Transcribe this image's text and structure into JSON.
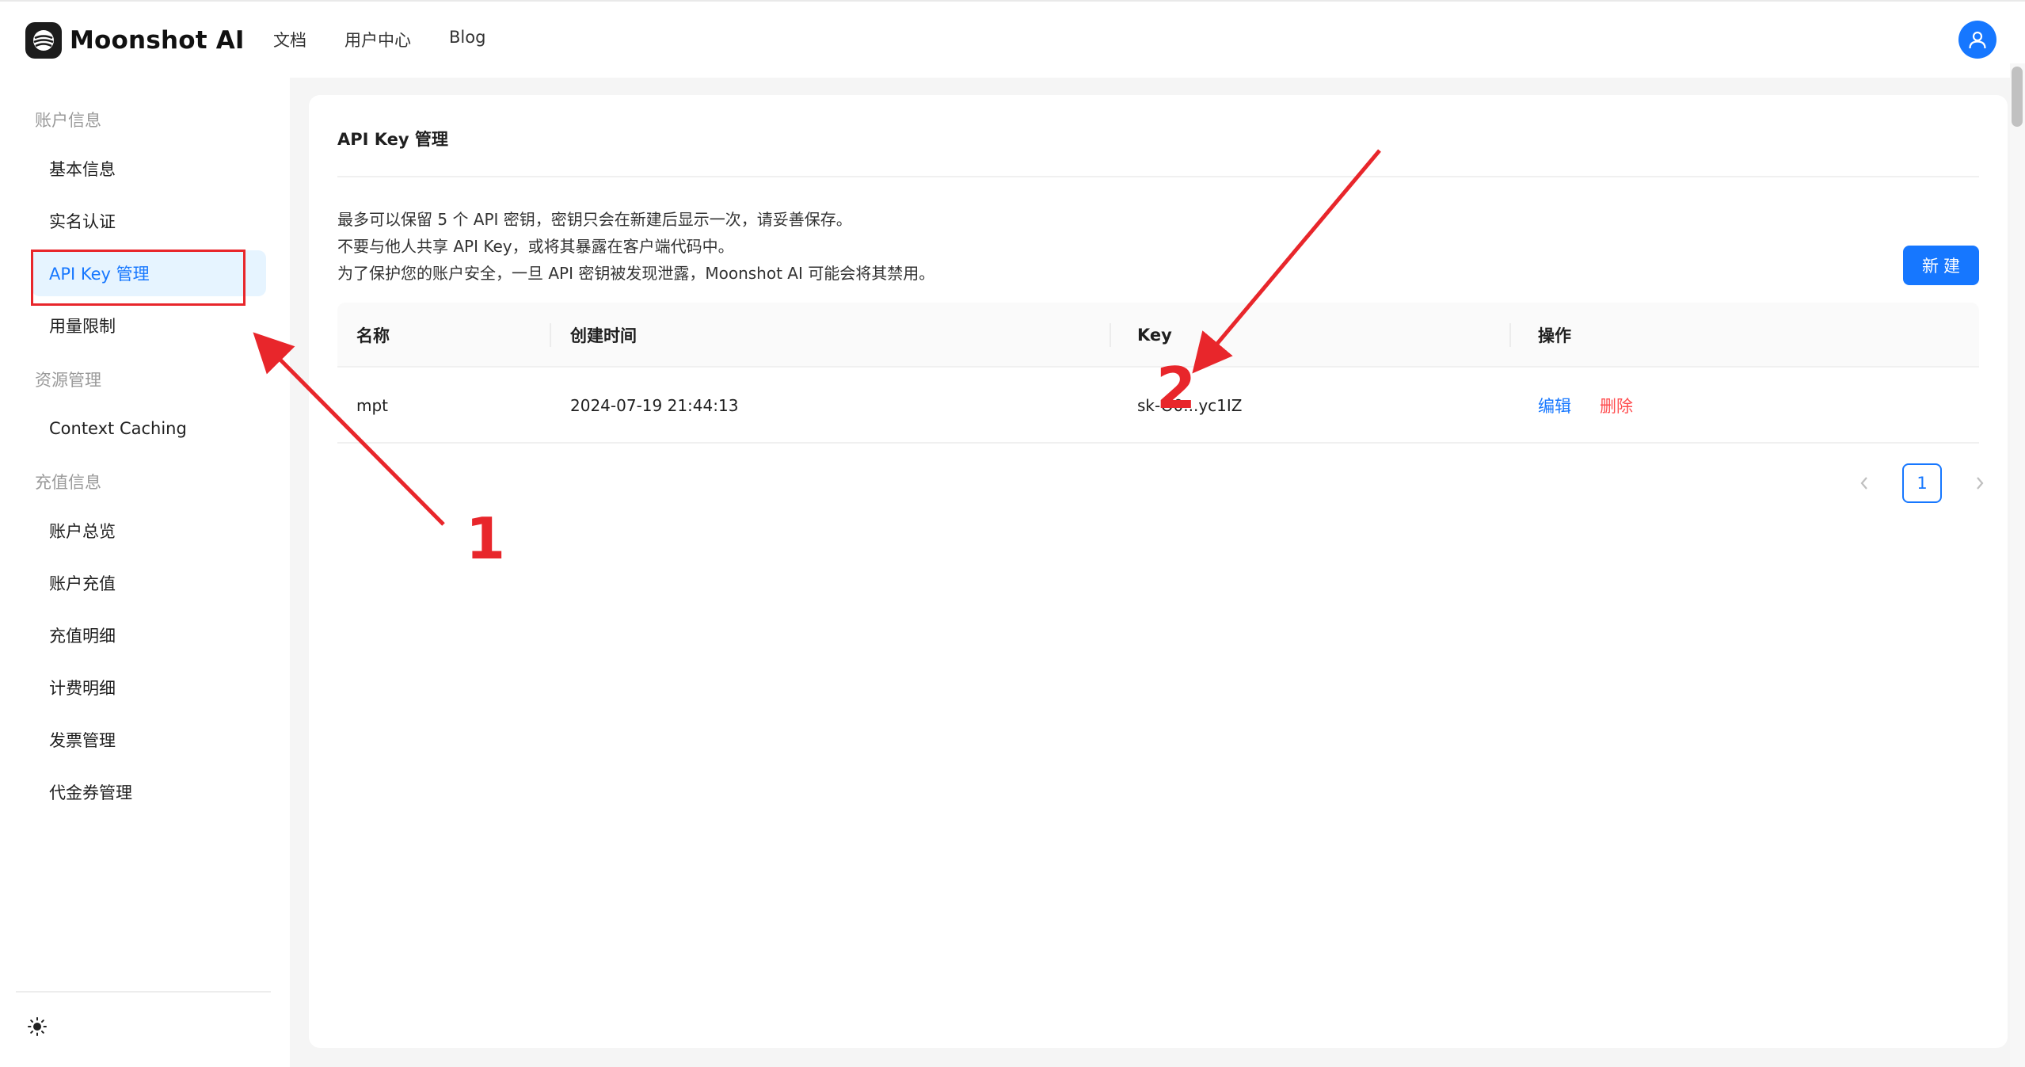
{
  "brand": {
    "name": "Moonshot AI"
  },
  "top_nav": {
    "items": [
      "文档",
      "用户中心",
      "Blog"
    ]
  },
  "sidebar": {
    "groups": [
      {
        "label": "账户信息",
        "items": [
          "基本信息",
          "实名认证",
          "API Key 管理",
          "用量限制"
        ]
      },
      {
        "label": "资源管理",
        "items": [
          "Context Caching"
        ]
      },
      {
        "label": "充值信息",
        "items": [
          "账户总览",
          "账户充值",
          "充值明细",
          "计费明细",
          "发票管理",
          "代金券管理"
        ]
      }
    ],
    "active_item": "API Key 管理"
  },
  "main": {
    "title": "API Key 管理",
    "notice_lines": [
      "最多可以保留 5 个 API 密钥，密钥只会在新建后显示一次，请妥善保存。",
      "不要与他人共享 API Key，或将其暴露在客户端代码中。",
      "为了保护您的账户安全，一旦 API 密钥被发现泄露，Moonshot AI 可能会将其禁用。"
    ],
    "new_button": "新建",
    "table": {
      "headers": [
        "名称",
        "创建时间",
        "Key",
        "操作"
      ],
      "rows": [
        {
          "name": "mpt",
          "created": "2024-07-19 21:44:13",
          "key": "sk-O0...yc1IZ",
          "edit": "编辑",
          "delete": "删除"
        }
      ]
    },
    "pagination": {
      "current_page": "1"
    }
  },
  "annotations": {
    "label_1": "1",
    "label_2": "2",
    "color": "#e8262b"
  },
  "colors": {
    "primary": "#1677ff",
    "danger": "#ff4d4f",
    "active_bg": "#e6f4ff"
  }
}
